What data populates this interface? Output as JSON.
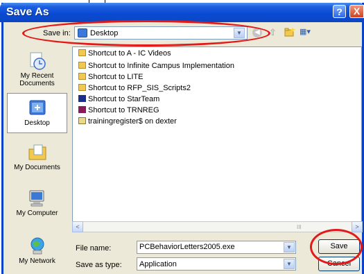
{
  "dialog": {
    "title": "Save As",
    "help_label": "?",
    "close_label": "X"
  },
  "toolbar": {
    "save_in_label": "Save in:",
    "save_in_value": "Desktop",
    "dropdown_arrow": "▼",
    "back_icon": "back-arrow-icon",
    "up_icon": "up-folder-icon",
    "new_folder_icon": "new-folder-icon",
    "views_icon": "views-menu-icon",
    "views_glyph": "▦▾",
    "up_glyph": "⇧",
    "back_glyph": "◀"
  },
  "places": [
    {
      "label": "My Recent Documents",
      "icon": "recent-documents-icon"
    },
    {
      "label": "Desktop",
      "icon": "desktop-icon"
    },
    {
      "label": "My Documents",
      "icon": "my-documents-icon"
    },
    {
      "label": "My Computer",
      "icon": "my-computer-icon"
    },
    {
      "label": "My Network",
      "icon": "my-network-icon"
    }
  ],
  "files": [
    {
      "name": "Shortcut to A - IC Videos",
      "icon": "folder-shortcut-icon"
    },
    {
      "name": "Shortcut to Infinite Campus Implementation",
      "icon": "folder-shortcut-icon"
    },
    {
      "name": "Shortcut to LITE",
      "icon": "folder-shortcut-icon"
    },
    {
      "name": "Shortcut to RFP_SIS_Scripts2",
      "icon": "folder-shortcut-icon"
    },
    {
      "name": "Shortcut to StarTeam",
      "icon": "app-shortcut-icon"
    },
    {
      "name": "Shortcut to TRNREG",
      "icon": "app-shortcut-icon"
    },
    {
      "name": "trainingregister$ on dexter",
      "icon": "network-drive-icon"
    }
  ],
  "scrollbar": {
    "left_glyph": "<",
    "right_glyph": ">",
    "grip": "III"
  },
  "form": {
    "file_name_label": "File name:",
    "file_name_value": "PCBehaviorLetters2005.exe",
    "save_as_type_label": "Save as type:",
    "save_as_type_value": "Application",
    "save_button": "Save",
    "cancel_button": "Cancel"
  },
  "colors": {
    "titlebar": "#0a4bd4",
    "dialog_bg": "#ece9d8",
    "annotation_red": "#e31818"
  }
}
